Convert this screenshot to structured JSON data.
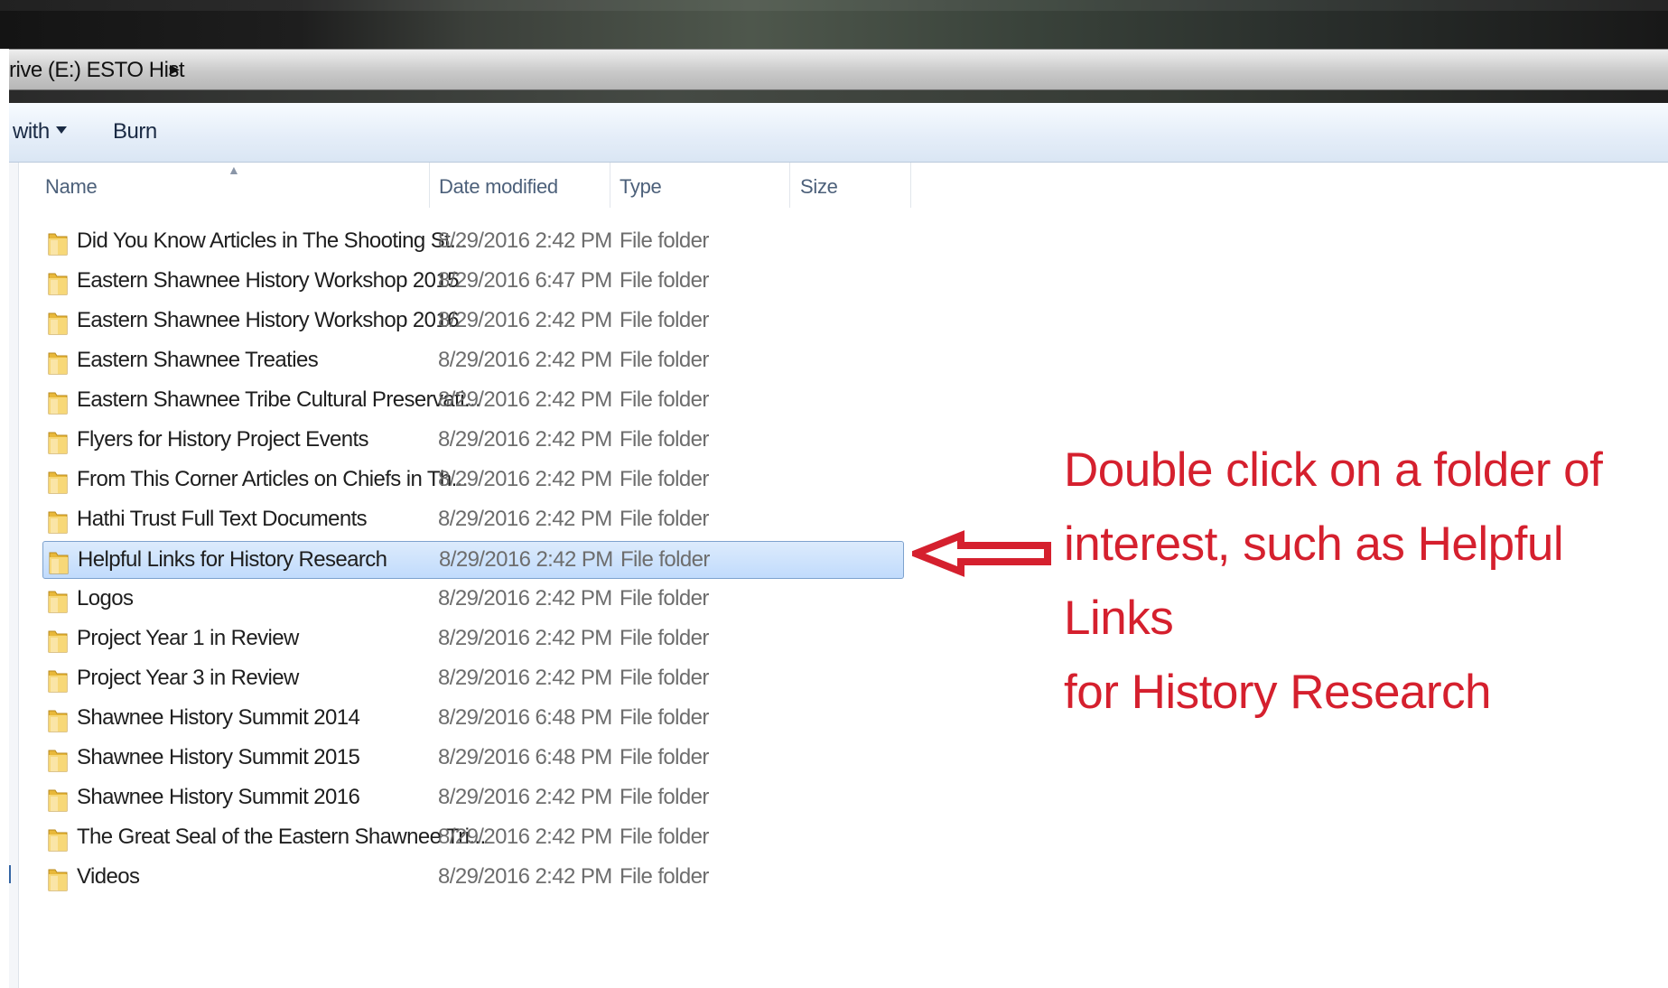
{
  "address_bar": {
    "path": "rive (E:) ESTO Hist",
    "arrow_icon": "breadcrumb-arrow-icon"
  },
  "toolbar": {
    "open_with_label": "with",
    "burn_label": "Burn"
  },
  "columns": {
    "name": "Name",
    "date_modified": "Date modified",
    "type": "Type",
    "size": "Size",
    "sort_icon": "sort-ascending-icon"
  },
  "files": [
    {
      "name": "Did You Know Articles in The Shooting St...",
      "date": "8/29/2016 2:42 PM",
      "type": "File folder"
    },
    {
      "name": "Eastern Shawnee History Workshop 2015",
      "date": "8/29/2016 6:47 PM",
      "type": "File folder"
    },
    {
      "name": "Eastern Shawnee History Workshop 2016",
      "date": "8/29/2016 2:42 PM",
      "type": "File folder"
    },
    {
      "name": "Eastern Shawnee Treaties",
      "date": "8/29/2016 2:42 PM",
      "type": "File folder"
    },
    {
      "name": "Eastern Shawnee Tribe Cultural Preservati...",
      "date": "8/29/2016 2:42 PM",
      "type": "File folder"
    },
    {
      "name": "Flyers for History Project Events",
      "date": "8/29/2016 2:42 PM",
      "type": "File folder"
    },
    {
      "name": "From This Corner Articles on Chiefs in Th...",
      "date": "8/29/2016 2:42 PM",
      "type": "File folder"
    },
    {
      "name": "Hathi Trust Full Text Documents",
      "date": "8/29/2016 2:42 PM",
      "type": "File folder"
    },
    {
      "name": "Helpful Links for History Research",
      "date": "8/29/2016 2:42 PM",
      "type": "File folder",
      "selected": true
    },
    {
      "name": "Logos",
      "date": "8/29/2016 2:42 PM",
      "type": "File folder"
    },
    {
      "name": "Project Year 1 in Review",
      "date": "8/29/2016 2:42 PM",
      "type": "File folder"
    },
    {
      "name": "Project Year 3 in Review",
      "date": "8/29/2016 2:42 PM",
      "type": "File folder"
    },
    {
      "name": "Shawnee History Summit 2014",
      "date": "8/29/2016 6:48 PM",
      "type": "File folder"
    },
    {
      "name": "Shawnee History Summit 2015",
      "date": "8/29/2016 6:48 PM",
      "type": "File folder"
    },
    {
      "name": "Shawnee History Summit 2016",
      "date": "8/29/2016 2:42 PM",
      "type": "File folder"
    },
    {
      "name": "The Great Seal of the Eastern Shawnee Tri...",
      "date": "8/29/2016 2:42 PM",
      "type": "File folder"
    },
    {
      "name": "Videos",
      "date": "8/29/2016 2:42 PM",
      "type": "File folder"
    }
  ],
  "file_icon": "folder-icon",
  "annotation": {
    "lines": [
      "Double click on a folder of",
      "interest, such as Helpful Links",
      "for History Research"
    ],
    "color": "#d5202e",
    "arrow_icon": "left-arrow-icon"
  }
}
